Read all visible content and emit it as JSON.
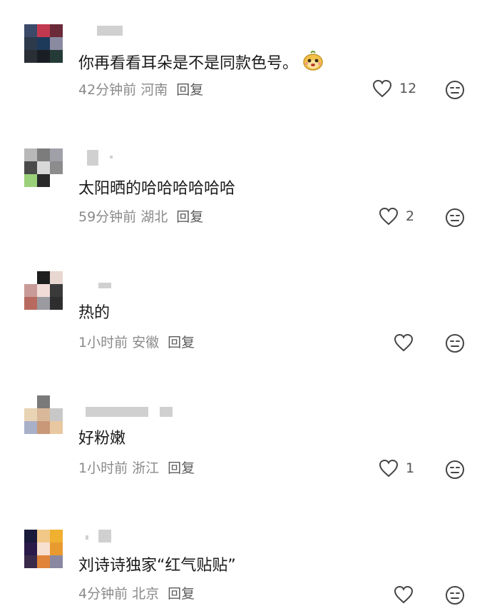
{
  "comments": [
    {
      "text": "你再看看耳朵是不是同款色号。",
      "has_emoji": true,
      "time": "42分钟前",
      "location": "河南",
      "reply": "回复",
      "likes": "12",
      "avatar": [
        "#3c4a6a",
        "#c2394f",
        "#6a2a3a",
        "#2c3a4c",
        "#1e3a5a",
        "#8a8aa0",
        "#2a2f36",
        "#1a1e24",
        "#243a36"
      ]
    },
    {
      "text": "太阳晒的哈哈哈哈哈哈",
      "has_emoji": false,
      "time": "59分钟前",
      "location": "湖北",
      "reply": "回复",
      "likes": "2",
      "avatar": [
        "#b8b8b8",
        "#7c7c7c",
        "#a0a0a8",
        "#4a4a4a",
        "#d8d8d8",
        "#8c8c8c",
        "#9ad07a",
        "#2a2a2a",
        "#ffffff"
      ]
    },
    {
      "text": "热的",
      "has_emoji": false,
      "time": "1小时前",
      "location": "安徽",
      "reply": "回复",
      "likes": "",
      "avatar": [
        "#ffffff",
        "#1e1e1e",
        "#e8d6d0",
        "#c89a98",
        "#f2dcd8",
        "#3a3a3a",
        "#b86a60",
        "#9a9aa0",
        "#2e2e2e"
      ]
    },
    {
      "text": "好粉嫩",
      "has_emoji": false,
      "time": "1小时前",
      "location": "浙江",
      "reply": "回复",
      "likes": "1",
      "avatar": [
        "#ffffff",
        "#7a7a7a",
        "#ffffff",
        "#e8d4b4",
        "#d8b898",
        "#c8c8c8",
        "#a8b0c8",
        "#c89878",
        "#e8c8a0"
      ]
    },
    {
      "text": "刘诗诗独家“红气贴贴”",
      "has_emoji": false,
      "time": "4分钟前",
      "location": "北京",
      "reply": "回复",
      "likes": "",
      "avatar": [
        "#1a1a3a",
        "#f2c888",
        "#f0b030",
        "#2a1a4a",
        "#f8e0d0",
        "#e89a30",
        "#3a2a4a",
        "#e0843a",
        "#8a88a0"
      ]
    }
  ]
}
